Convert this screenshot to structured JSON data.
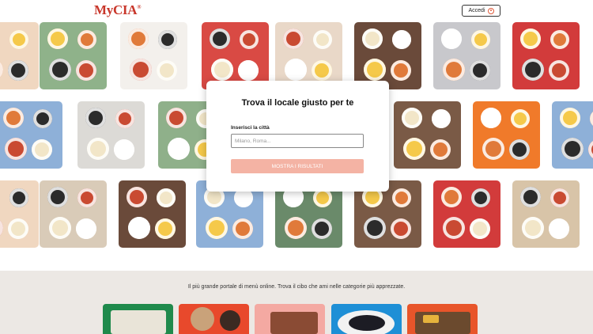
{
  "header": {
    "logo": "MyCIA",
    "logo_mark": "®",
    "login_label": "Accedi",
    "login_icon": "user-icon"
  },
  "modal": {
    "title": "Trova il locale giusto per te",
    "city_label": "Inserisci la città",
    "city_placeholder": "Milano, Roma...",
    "city_value": "",
    "submit_label": "MOSTRA I RISULTATI"
  },
  "footer": {
    "tagline": "Il più grande portale di menù online. Trova il cibo che ami nelle categorie più apprezzate."
  },
  "colors": {
    "brand": "#c8362a",
    "button_disabled": "#f4b3a4",
    "section_bg": "#ece8e4"
  }
}
